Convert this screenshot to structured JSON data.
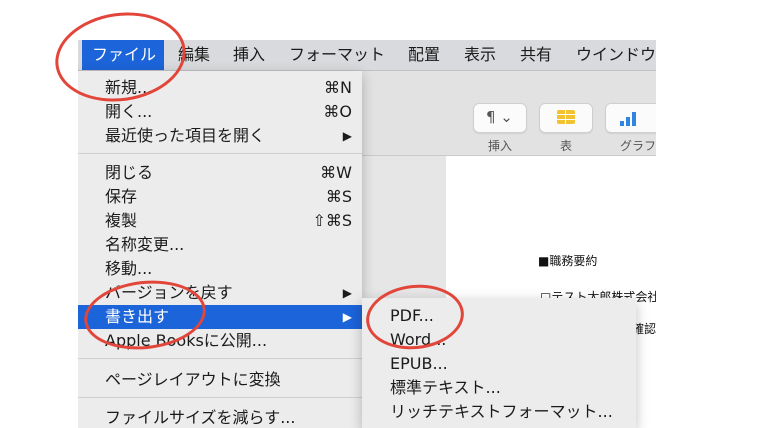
{
  "menubar": {
    "items": [
      "ファイル",
      "編集",
      "挿入",
      "フォーマット",
      "配置",
      "表示",
      "共有",
      "ウインドウ"
    ]
  },
  "toolbar": {
    "buttons": [
      {
        "icon": "pilcrow-icon",
        "symbol": "¶ ⌄",
        "label": "挿入"
      },
      {
        "icon": "table-icon",
        "label": "表"
      },
      {
        "icon": "chart-icon",
        "label": "グラフ"
      }
    ]
  },
  "document": {
    "lines": [
      "■職務要約",
      "□テスト太郎株式会社",
      "確認"
    ]
  },
  "file_menu": {
    "items": [
      {
        "label": "新規...",
        "shortcut": "⌘N"
      },
      {
        "label": "開く...",
        "shortcut": "⌘O"
      },
      {
        "label": "最近使った項目を開く",
        "shortcut": "▶"
      },
      {
        "label": "閉じる",
        "shortcut": "⌘W"
      },
      {
        "label": "保存",
        "shortcut": "⌘S"
      },
      {
        "label": "複製",
        "shortcut": "⇧⌘S"
      },
      {
        "label": "名称変更...",
        "shortcut": ""
      },
      {
        "label": "移動...",
        "shortcut": ""
      },
      {
        "label": "バージョンを戻す",
        "shortcut": "▶"
      },
      {
        "label": "書き出す",
        "shortcut": "▶"
      },
      {
        "label": "Apple Booksに公開...",
        "shortcut": ""
      },
      {
        "label": "ページレイアウトに変換",
        "shortcut": ""
      },
      {
        "label": "ファイルサイズを減らす...",
        "shortcut": ""
      }
    ]
  },
  "export_submenu": {
    "items": [
      "PDF...",
      "Word...",
      "EPUB...",
      "標準テキスト...",
      "リッチテキストフォーマット..."
    ]
  },
  "colors": {
    "highlight": "#1c64d9",
    "annotation": "#e2463a",
    "menu_bg": "#ececec"
  }
}
